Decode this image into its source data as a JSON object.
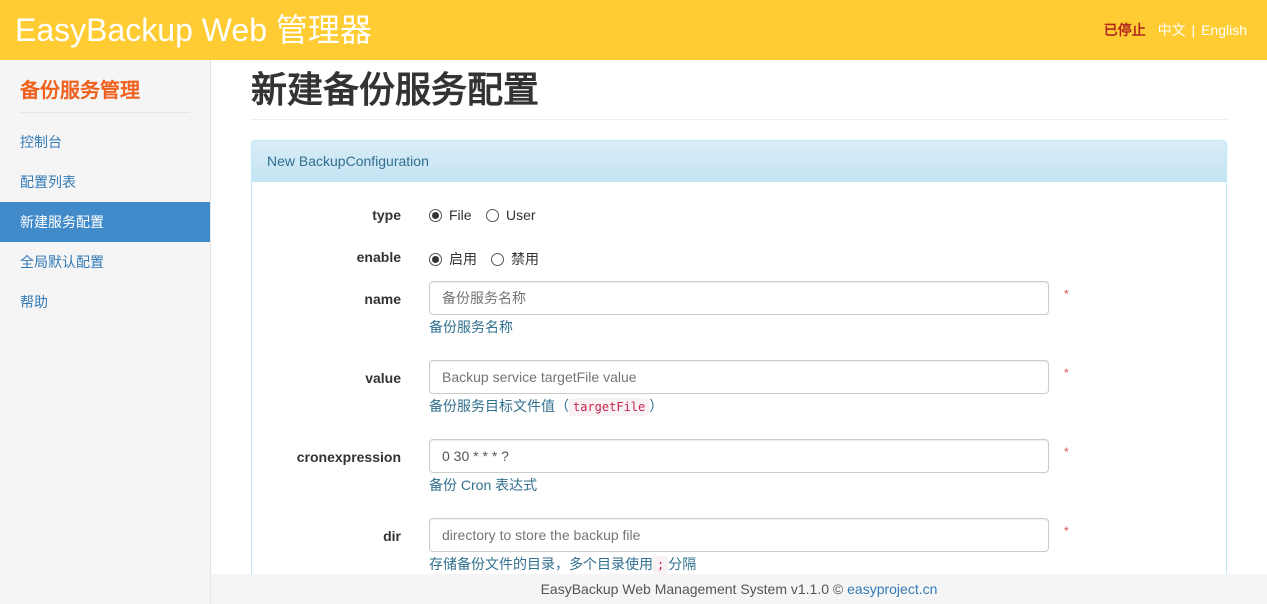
{
  "app": {
    "title": "EasyBackup Web 管理器",
    "status": "已停止",
    "lang_zh": "中文",
    "lang_sep": "|",
    "lang_en": "English"
  },
  "sidebar": {
    "title": "备份服务管理",
    "items": [
      {
        "label": "控制台"
      },
      {
        "label": "配置列表"
      },
      {
        "label": "新建服务配置"
      },
      {
        "label": "全局默认配置"
      },
      {
        "label": "帮助"
      }
    ],
    "active_index": 2
  },
  "page": {
    "title": "新建备份服务配置",
    "panel_heading": "New BackupConfiguration"
  },
  "form": {
    "type": {
      "label": "type",
      "options": [
        "File",
        "User"
      ],
      "selected": "File"
    },
    "enable": {
      "label": "enable",
      "options": [
        "启用",
        "禁用"
      ],
      "selected": "启用"
    },
    "name": {
      "label": "name",
      "value": "",
      "placeholder": "备份服务名称",
      "help": "备份服务名称",
      "required_mark": "*"
    },
    "value": {
      "label": "value",
      "value": "",
      "placeholder": "Backup service targetFile value",
      "help_prefix": "备份服务目标文件值（",
      "help_code": "targetFile",
      "help_suffix": "）",
      "required_mark": "*"
    },
    "cronexpression": {
      "label": "cronexpression",
      "value": "0 30 * * * ?",
      "placeholder": "",
      "help": "备份 Cron 表达式",
      "required_mark": "*"
    },
    "dir": {
      "label": "dir",
      "value": "",
      "placeholder": "directory to store the backup file",
      "help_prefix": "存储备份文件的目录，多个目录使用",
      "help_code": ";",
      "help_suffix": "分隔",
      "required_mark": "*"
    }
  },
  "footer": {
    "text": "EasyBackup Web Management System v1.1.0 ©",
    "link": "easyproject.cn"
  },
  "colors": {
    "topbar": "#ffcc33",
    "accent": "#f0611e",
    "active_nav": "#428bca",
    "status": "#b22a1d",
    "link": "#337ab7"
  }
}
